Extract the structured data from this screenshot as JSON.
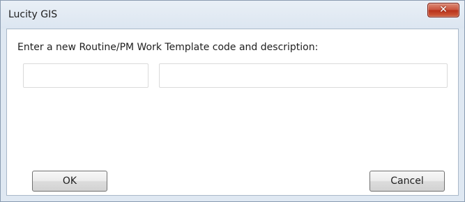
{
  "window": {
    "title": "Lucity GIS",
    "close_glyph": "✕"
  },
  "dialog": {
    "prompt": "Enter a new Routine/PM Work Template code and description:",
    "code_field": {
      "value": "",
      "placeholder": ""
    },
    "description_field": {
      "value": "",
      "placeholder": ""
    },
    "ok_label": "OK",
    "cancel_label": "Cancel"
  },
  "colors": {
    "titlebar": "#dce6f1",
    "close_button": "#c9533c",
    "client_background": "#ffffff",
    "button_border": "#707070"
  }
}
